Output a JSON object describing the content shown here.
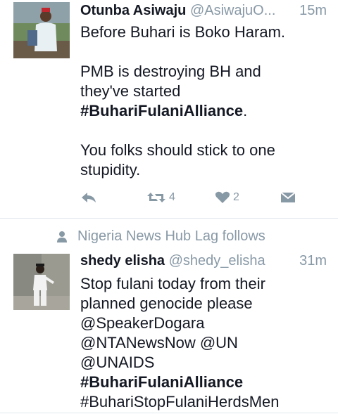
{
  "tweets": [
    {
      "name": "Otunba Asiwaju",
      "handle": "@AsiwajuO...",
      "time": "15m",
      "lines_p1": [
        "Before Buhari is Boko Haram."
      ],
      "lines_p2": [
        "PMB is destroying BH and",
        "they've started"
      ],
      "hashtag": "#BuhariFulaniAlliance",
      "hashtag_suffix": ".",
      "lines_p3": [
        "You folks should stick to one",
        "stupidity."
      ],
      "retweets": "4",
      "likes": "2"
    },
    {
      "context": "Nigeria News Hub Lag follows",
      "name": "shedy elisha",
      "handle": "@shedy_elisha",
      "time": "31m",
      "lines": [
        "Stop fulani today from their",
        "planned genocide please",
        "@SpeakerDogara",
        "@NTANewsNow @UN",
        "@UNAIDS"
      ],
      "hashtag": "#BuhariFulaniAlliance",
      "last_line": "#BuhariStopFulaniHerdsMen"
    }
  ],
  "colors": {
    "text": "#141823",
    "meta": "#8899a6",
    "divider": "#e1e8ed"
  }
}
